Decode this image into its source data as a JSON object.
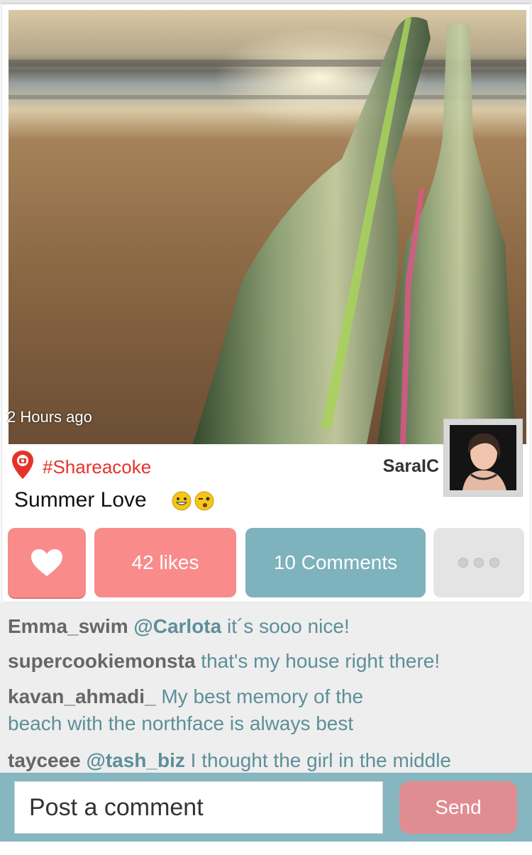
{
  "post": {
    "timestamp": "2 Hours ago",
    "hashtag": "#Shareacoke",
    "username": "SaraIC",
    "caption": "Summer Love"
  },
  "actions": {
    "likes_label": "42 likes",
    "comments_label": "10 Comments"
  },
  "comments": [
    {
      "user": "Emma_swim",
      "mention": "@Carlota",
      "text": " it´s sooo nice!"
    },
    {
      "user": "supercookiemonsta",
      "mention": "",
      "text": " that's my house right there!"
    },
    {
      "user": "kavan_ahmadi_",
      "mention": "",
      "text": " My best memory of the",
      "text2": "beach with the northface is always best"
    },
    {
      "user": "tayceee",
      "mention": "@tash_biz",
      "text": " I thought the girl in the middle"
    }
  ],
  "composer": {
    "placeholder": "Post a comment",
    "send_label": "Send"
  },
  "icons": {
    "like": "heart-icon",
    "location": "location-pin-icon",
    "more": "more-dots-icon"
  },
  "colors": {
    "accent_red": "#e6332a",
    "like_pink": "#f98b8b",
    "comments_teal": "#7eb2bc",
    "input_bar": "#86b6bf",
    "send_button": "#e08d91"
  }
}
